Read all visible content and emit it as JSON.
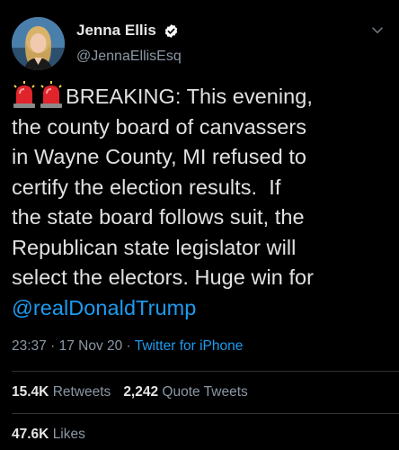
{
  "author": {
    "name": "Jenna Ellis",
    "handle": "@JennaEllisEsq",
    "verified": true
  },
  "tweet": {
    "lines": [
      "BREAKING: This evening,",
      "the county board of canvassers",
      "in Wayne County, MI refused to",
      "certify the election results.  If",
      "the state board follows suit, the",
      "Republican state legislator will",
      "select the electors. Huge win for"
    ],
    "mention": "@realDonaldTrump",
    "leading_icons": [
      "police-light-icon",
      "police-light-icon"
    ]
  },
  "meta": {
    "time": "23:37",
    "separator1": " · ",
    "date": "17 Nov 20",
    "separator2": " · ",
    "source": "Twitter for iPhone"
  },
  "stats": {
    "retweets_count": "15.4K",
    "retweets_label": "Retweets",
    "quote_count": "2,242",
    "quote_label": "Quote Tweets",
    "likes_count": "47.6K",
    "likes_label": "Likes"
  },
  "colors": {
    "background": "#000000",
    "link": "#1d9bf0",
    "secondary_text": "#8b98a5",
    "divider": "#2f3336"
  }
}
